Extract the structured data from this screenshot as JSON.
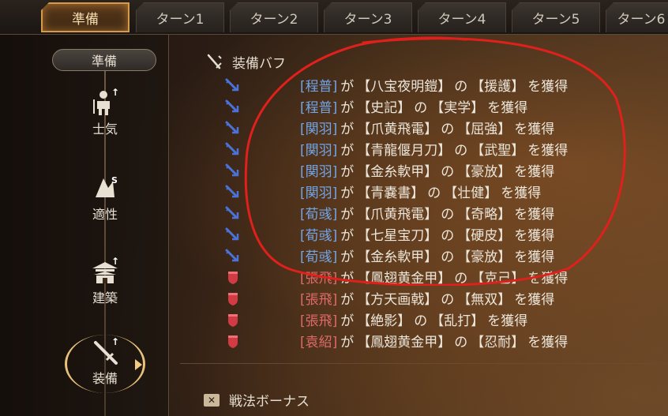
{
  "tabs": [
    {
      "label": "準備",
      "active": true
    },
    {
      "label": "ターン1",
      "active": false
    },
    {
      "label": "ターン2",
      "active": false
    },
    {
      "label": "ターン3",
      "active": false
    },
    {
      "label": "ターン4",
      "active": false
    },
    {
      "label": "ターン5",
      "active": false
    },
    {
      "label": "ターン6",
      "active": false
    }
  ],
  "sidebar": {
    "header": "準備",
    "items": [
      {
        "label": "士気",
        "icon": "soldier-icon"
      },
      {
        "label": "適性",
        "icon": "aptitude-icon"
      },
      {
        "label": "建築",
        "icon": "building-icon"
      },
      {
        "label": "装備",
        "icon": "sword-icon",
        "active": true
      }
    ]
  },
  "main": {
    "section_title": "装備バフ",
    "buffs": [
      {
        "name": "[程普]",
        "team": "blue",
        "ga": "が",
        "item": "【八宝夜明鎧】",
        "no": "の",
        "effect": "【援護】",
        "suffix": "を獲得"
      },
      {
        "name": "[程普]",
        "team": "blue",
        "ga": "が",
        "item": "【史記】",
        "no": "の",
        "effect": "【実学】",
        "suffix": "を獲得"
      },
      {
        "name": "[関羽]",
        "team": "blue",
        "ga": "が",
        "item": "【爪黄飛電】",
        "no": "の",
        "effect": "【屈強】",
        "suffix": "を獲得"
      },
      {
        "name": "[関羽]",
        "team": "blue",
        "ga": "が",
        "item": "【青龍偃月刀】",
        "no": "の",
        "effect": "【武聖】",
        "suffix": "を獲得"
      },
      {
        "name": "[関羽]",
        "team": "blue",
        "ga": "が",
        "item": "【金糸軟甲】",
        "no": "の",
        "effect": "【豪放】",
        "suffix": "を獲得"
      },
      {
        "name": "[関羽]",
        "team": "blue",
        "ga": "が",
        "item": "【青嚢書】",
        "no": "の",
        "effect": "【壮健】",
        "suffix": "を獲得"
      },
      {
        "name": "[荀彧]",
        "team": "blue",
        "ga": "が",
        "item": "【爪黄飛電】",
        "no": "の",
        "effect": "【奇略】",
        "suffix": "を獲得"
      },
      {
        "name": "[荀彧]",
        "team": "blue",
        "ga": "が",
        "item": "【七星宝刀】",
        "no": "の",
        "effect": "【硬皮】",
        "suffix": "を獲得"
      },
      {
        "name": "[荀彧]",
        "team": "blue",
        "ga": "が",
        "item": "【金糸軟甲】",
        "no": "の",
        "effect": "【豪放】",
        "suffix": "を獲得"
      },
      {
        "name": "[張飛]",
        "team": "red",
        "ga": "が",
        "item": "【鳳翅黄金甲】",
        "no": "の",
        "effect": "【克己】",
        "suffix": "を獲得"
      },
      {
        "name": "[張飛]",
        "team": "red",
        "ga": "が",
        "item": "【方天画戟】",
        "no": "の",
        "effect": "【無双】",
        "suffix": "を獲得"
      },
      {
        "name": "[張飛]",
        "team": "red",
        "ga": "が",
        "item": "【絶影】",
        "no": "の",
        "effect": "【乱打】",
        "suffix": "を獲得"
      },
      {
        "name": "[袁紹]",
        "team": "red",
        "ga": "が",
        "item": "【鳳翅黄金甲】",
        "no": "の",
        "effect": "【忍耐】",
        "suffix": "を獲得"
      }
    ],
    "sub_title": "戦法ボーナス"
  },
  "colors": {
    "blue_team": "#72a5e6",
    "red_team": "#e06a6a",
    "annotation": "#e0201c",
    "accent": "#d59a4a"
  }
}
